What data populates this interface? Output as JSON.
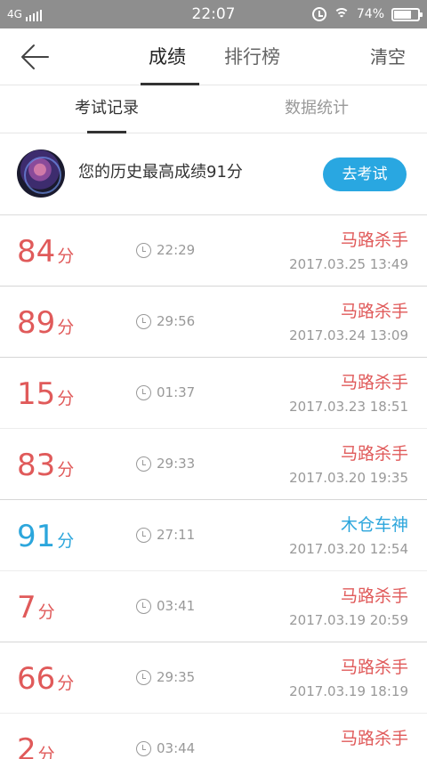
{
  "status_bar": {
    "network": "4G",
    "time": "22:07",
    "battery": "74%",
    "battery_level": 0.74,
    "icons": [
      "signal-icon",
      "alarm-icon",
      "wifi-icon",
      "battery-icon"
    ]
  },
  "header": {
    "back_icon": "back-arrow-icon",
    "tabs": [
      {
        "label": "成绩"
      },
      {
        "label": "排行榜"
      }
    ],
    "active_tab": "成绩",
    "clear_label": "清空"
  },
  "subtabs": [
    {
      "label": "考试记录"
    },
    {
      "label": "数据统计"
    }
  ],
  "active_subtab": "考试记录",
  "profile": {
    "best_text": "您的历史最高成绩91分",
    "exam_button": "去考试"
  },
  "colors": {
    "score_red": "#e05a5a",
    "score_blue": "#2ca6dc",
    "accent_button": "#29a7e1",
    "status_bar_bg": "#8e8e8e"
  },
  "records": [
    {
      "score": "84",
      "unit": "分",
      "duration": "22:29",
      "title": "马路杀手",
      "date": "2017.03.25  13:49"
    },
    {
      "score": "89",
      "unit": "分",
      "duration": "29:56",
      "title": "马路杀手",
      "date": "2017.03.24  13:09"
    },
    {
      "score": "15",
      "unit": "分",
      "duration": "01:37",
      "title": "马路杀手",
      "date": "2017.03.23  18:51"
    },
    {
      "score": "83",
      "unit": "分",
      "duration": "29:33",
      "title": "马路杀手",
      "date": "2017.03.20  19:35"
    },
    {
      "score": "91",
      "unit": "分",
      "duration": "27:11",
      "title": "木仓车神",
      "date": "2017.03.20  12:54"
    },
    {
      "score": "7",
      "unit": "分",
      "duration": "03:41",
      "title": "马路杀手",
      "date": "2017.03.19  20:59"
    },
    {
      "score": "66",
      "unit": "分",
      "duration": "29:35",
      "title": "马路杀手",
      "date": "2017.03.19  18:19"
    },
    {
      "score": "2",
      "unit": "分",
      "duration": "03:44",
      "title": "马路杀手",
      "date": ""
    }
  ]
}
